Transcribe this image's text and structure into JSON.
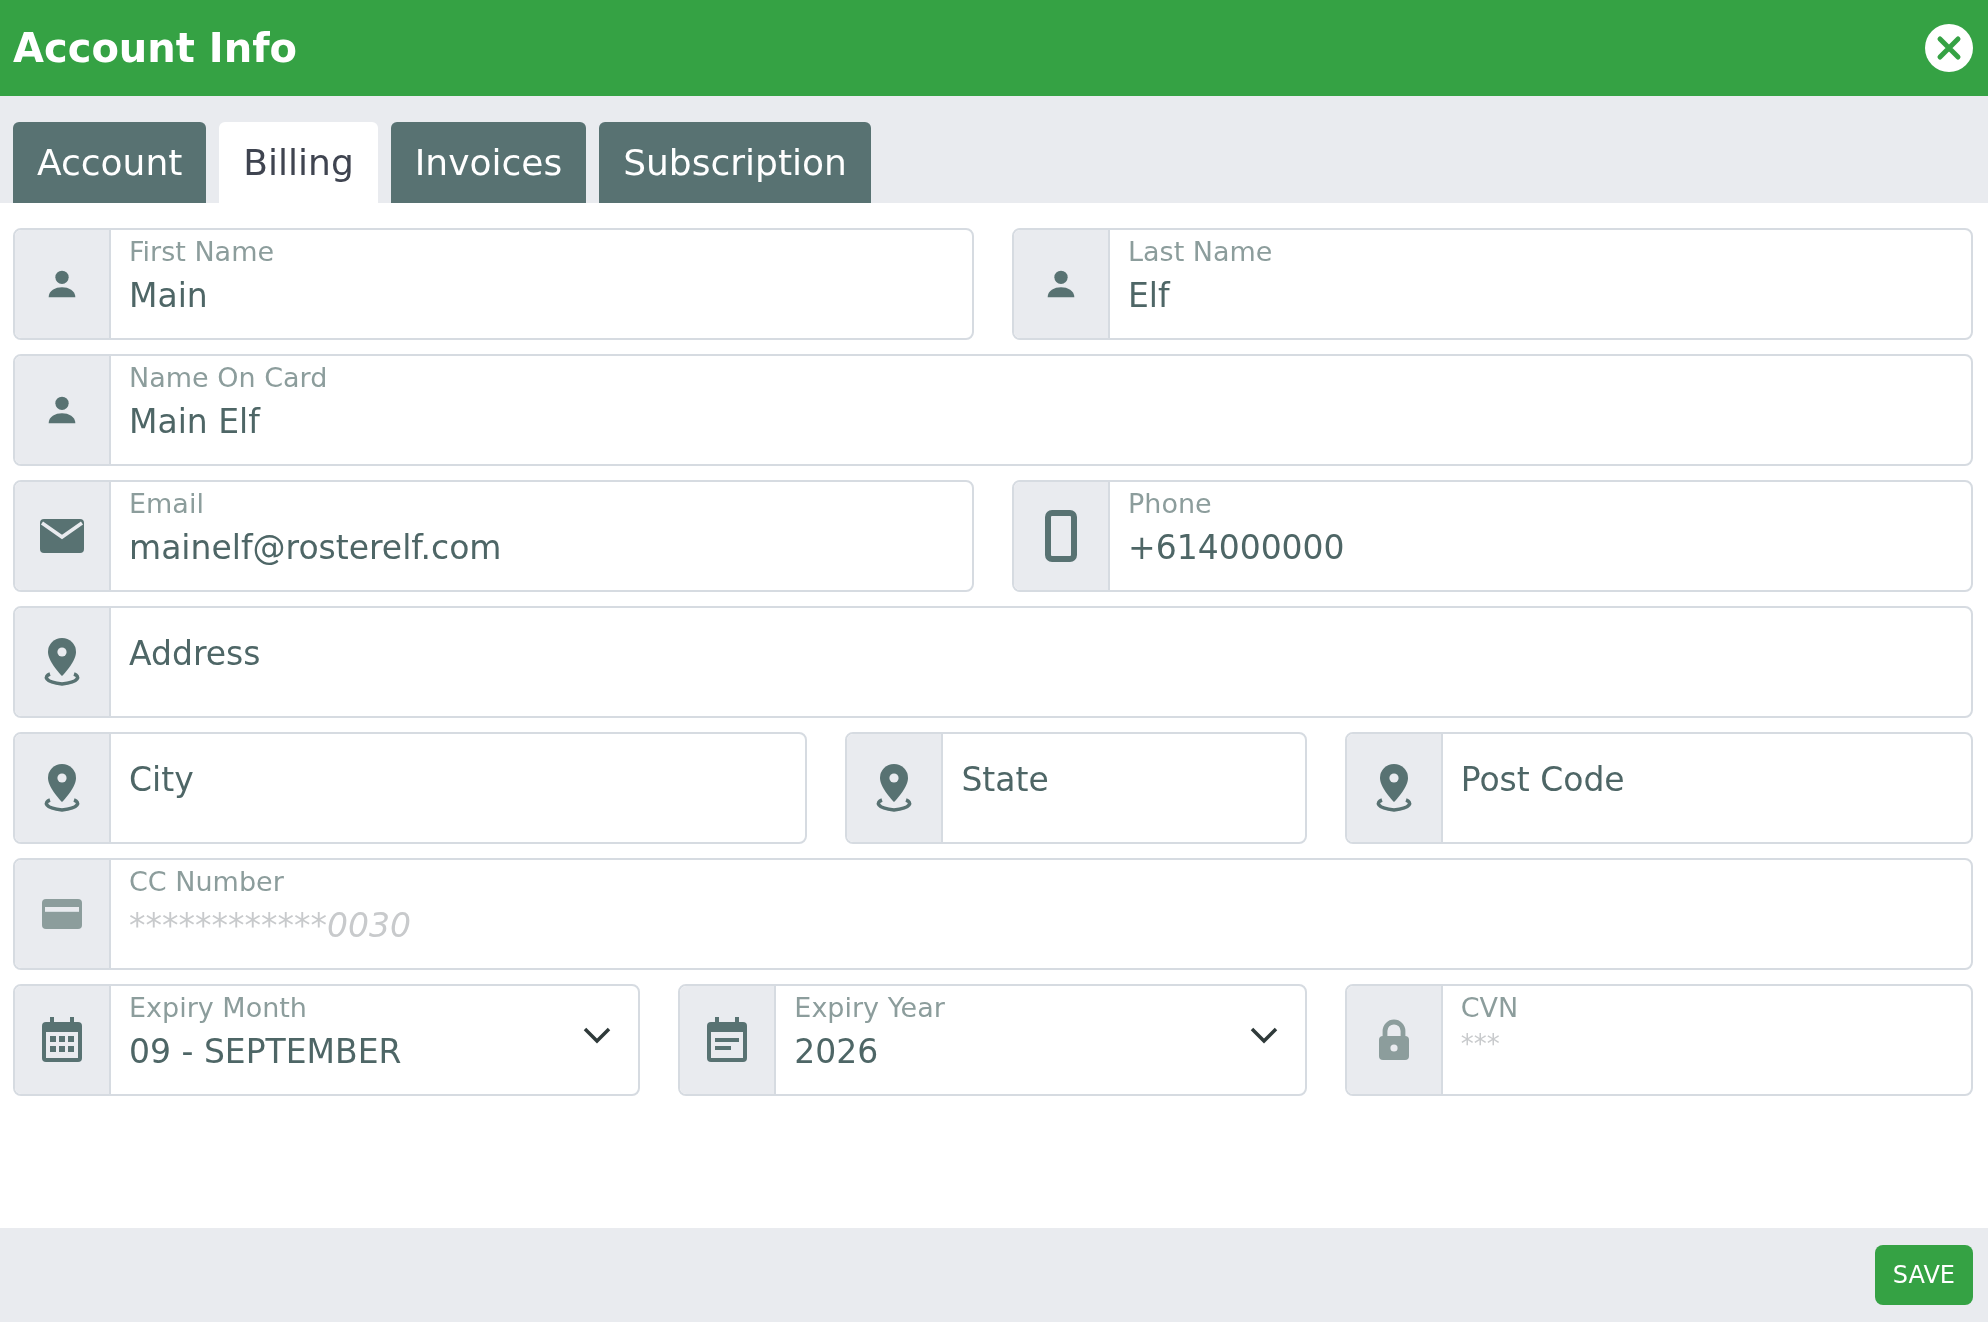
{
  "window": {
    "title": "Account Info"
  },
  "tabs": [
    {
      "label": "Account",
      "selected": false
    },
    {
      "label": "Billing",
      "selected": true
    },
    {
      "label": "Invoices",
      "selected": false
    },
    {
      "label": "Subscription",
      "selected": false
    }
  ],
  "form_rows": [
    [
      {
        "kind": "text",
        "label": "First Name",
        "value": "Main"
      },
      {
        "kind": "text",
        "label": "Last Name",
        "value": "Elf"
      }
    ],
    [
      {
        "kind": "text",
        "label": "Name On Card",
        "value": "Main Elf"
      }
    ],
    [
      {
        "kind": "text",
        "label": "Email",
        "value": "mainelf@rosterelf.com"
      },
      {
        "kind": "text",
        "label": "Phone",
        "value": "+614000000"
      }
    ],
    [
      {
        "kind": "text",
        "placeholder": "Address"
      }
    ],
    [
      {
        "kind": "text",
        "placeholder": "City"
      },
      {
        "kind": "text",
        "placeholder": "State"
      },
      {
        "kind": "text",
        "placeholder": "Post Code"
      }
    ],
    [
      {
        "kind": "masked",
        "label": "CC Number",
        "placeholder": "************0030"
      }
    ],
    [
      {
        "kind": "select",
        "label": "Expiry Month",
        "value": "09 - SEPTEMBER"
      },
      {
        "kind": "select",
        "label": "Expiry Year",
        "value": "2026"
      },
      {
        "kind": "masked",
        "label": "CVN",
        "placeholder": "***"
      }
    ]
  ],
  "buttons": [
    {
      "label": "SAVE"
    }
  ]
}
